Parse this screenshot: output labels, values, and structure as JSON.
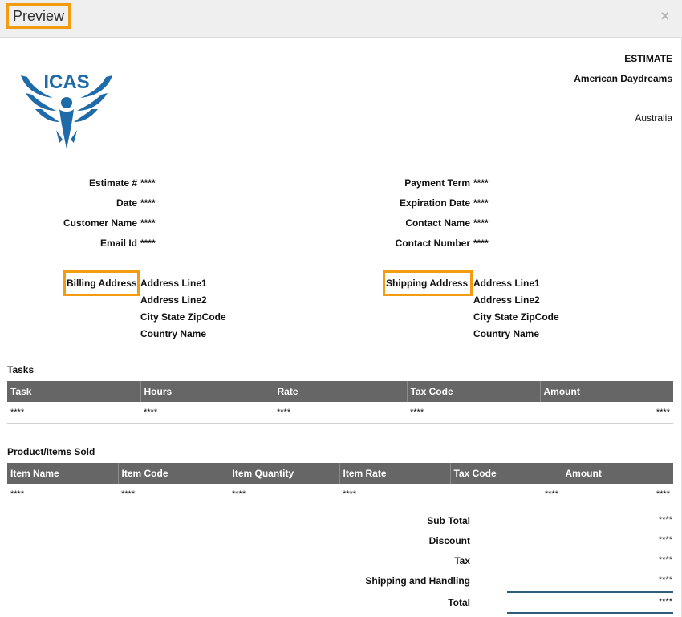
{
  "modal": {
    "title": "Preview",
    "close_label": "×"
  },
  "logo": {
    "text": "ICAS",
    "color": "#1f6aa8"
  },
  "company": {
    "doc_type": "ESTIMATE",
    "name": "American Daydreams",
    "country": "Australia"
  },
  "details_left": [
    {
      "label": "Estimate #",
      "value": "****"
    },
    {
      "label": "Date",
      "value": "****"
    },
    {
      "label": "Customer Name",
      "value": "****"
    },
    {
      "label": "Email Id",
      "value": "****"
    }
  ],
  "details_right": [
    {
      "label": "Payment Term",
      "value": "****"
    },
    {
      "label": "Expiration Date",
      "value": "****"
    },
    {
      "label": "Contact Name",
      "value": "****"
    },
    {
      "label": "Contact Number",
      "value": "****"
    }
  ],
  "billing": {
    "label": "Billing Address",
    "lines": [
      "Address Line1",
      "Address Line2",
      "City State ZipCode",
      "Country Name"
    ]
  },
  "shipping": {
    "label": "Shipping Address",
    "lines": [
      "Address Line1",
      "Address Line2",
      "City State ZipCode",
      "Country Name"
    ]
  },
  "tasks": {
    "title": "Tasks",
    "columns": [
      "Task",
      "Hours",
      "Rate",
      "Tax Code",
      "Amount"
    ],
    "rows": [
      [
        "****",
        "****",
        "****",
        "****",
        "****"
      ]
    ]
  },
  "products": {
    "title": "Product/Items Sold",
    "columns": [
      "Item Name",
      "Item Code",
      "Item Quantity",
      "Item Rate",
      "Tax Code",
      "Amount"
    ],
    "rows": [
      [
        "****",
        "****",
        "****",
        "****",
        "****",
        "****"
      ]
    ]
  },
  "summary": [
    {
      "label": "Sub Total",
      "value": "****"
    },
    {
      "label": "Discount",
      "value": "****"
    },
    {
      "label": "Tax",
      "value": "****"
    },
    {
      "label": "Shipping and Handling",
      "value": "****"
    },
    {
      "label": "Total",
      "value": "****"
    }
  ],
  "colors": {
    "highlight": "#f39c12",
    "table_header": "#666666",
    "total_line": "#2d5d7b"
  }
}
